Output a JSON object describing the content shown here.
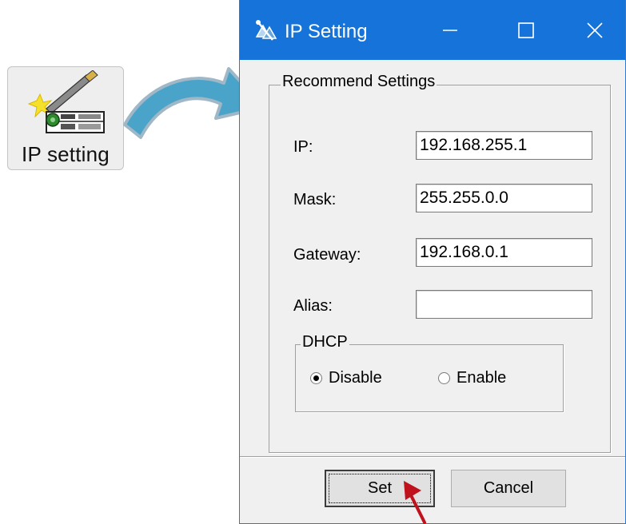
{
  "toolbar_button": {
    "label": "IP setting",
    "icon": "ip-setting-tool-icon"
  },
  "dialog": {
    "title": "IP Setting",
    "icon": "network-settings-icon",
    "controls": {
      "minimize": "minimize-icon",
      "maximize": "maximize-icon",
      "close": "close-icon"
    },
    "group_title": "Recommend Settings",
    "fields": {
      "ip_label": "IP:",
      "ip_value": "192.168.255.1",
      "mask_label": "Mask:",
      "mask_value": "255.255.0.0",
      "gateway_label": "Gateway:",
      "gateway_value": "192.168.0.1",
      "alias_label": "Alias:",
      "alias_value": ""
    },
    "dhcp": {
      "title": "DHCP",
      "options": [
        {
          "label": "Disable",
          "selected": true
        },
        {
          "label": "Enable",
          "selected": false
        }
      ]
    },
    "buttons": {
      "set": "Set",
      "cancel": "Cancel"
    }
  },
  "colors": {
    "titlebar": "#1573d9",
    "dialog_bg": "#f0f0f0",
    "arrow": "#4aa3c8",
    "pointer": "#c0121d"
  }
}
